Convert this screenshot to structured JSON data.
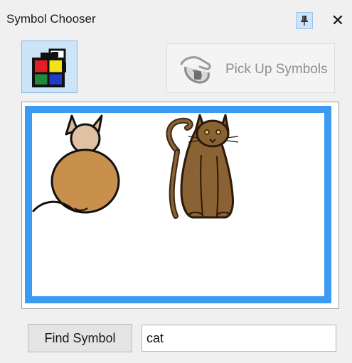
{
  "window": {
    "title": "Symbol Chooser",
    "close_glyph": "✕"
  },
  "toolbar": {
    "palette_icon": "color-palette-icon",
    "pickup_label": "Pick Up Symbols",
    "pickup_icon": "hand-pickup-icon",
    "pickup_enabled": false
  },
  "canvas": {
    "symbols": [
      {
        "name": "cartoon-cat-symbol",
        "description_icon": "cat-back-view"
      },
      {
        "name": "realistic-cat-symbol",
        "description_icon": "cat-sitting"
      }
    ],
    "selection_color": "#3c9bf0"
  },
  "search": {
    "button_label": "Find Symbol",
    "value": "cat"
  }
}
